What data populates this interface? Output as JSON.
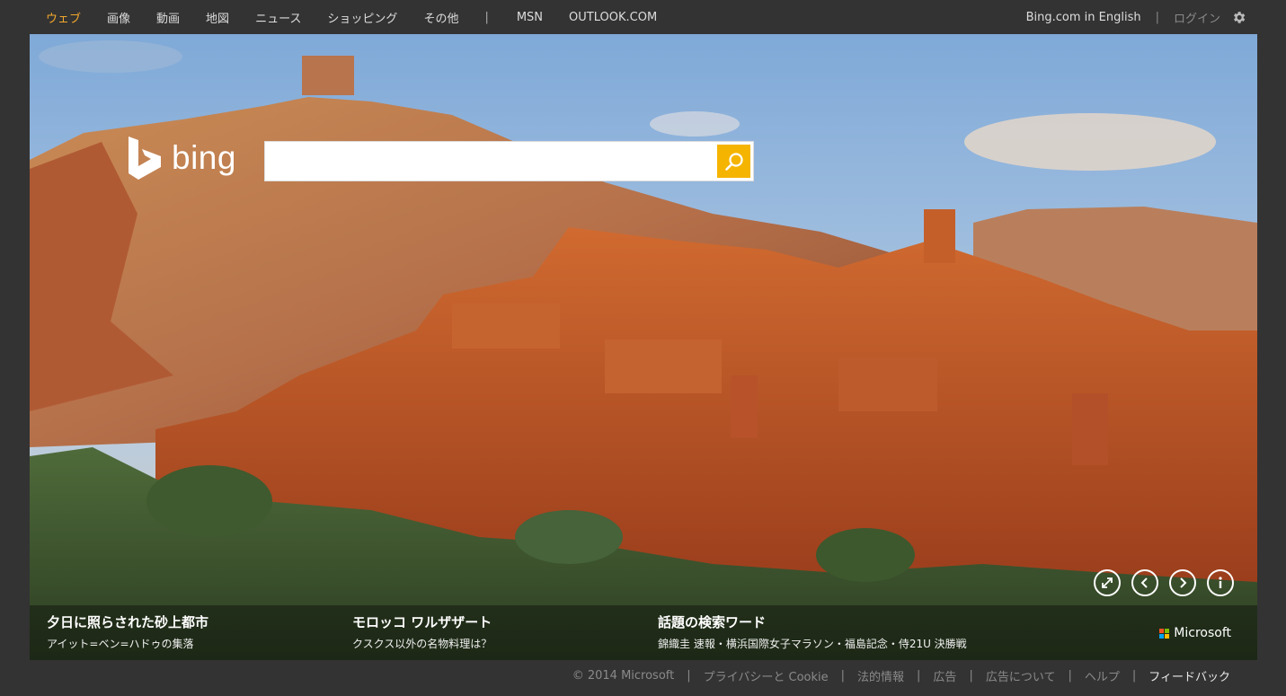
{
  "nav": {
    "left": [
      {
        "label": "ウェブ",
        "active": true
      },
      {
        "label": "画像"
      },
      {
        "label": "動画"
      },
      {
        "label": "地図"
      },
      {
        "label": "ニュース"
      },
      {
        "label": "ショッピング"
      },
      {
        "label": "その他"
      }
    ],
    "separator": "|",
    "right_links": [
      {
        "label": "MSN"
      },
      {
        "label": "OUTLOOK.COM"
      }
    ],
    "english_link": "Bing.com in English",
    "login_link": "ログイン",
    "settings_icon": "gear-icon"
  },
  "logo": {
    "word": "bing"
  },
  "search": {
    "value": "",
    "placeholder": ""
  },
  "controls": [
    "expand-icon",
    "previous-icon",
    "next-icon",
    "info-icon"
  ],
  "stories": [
    {
      "title": "夕日に照らされた砂上都市",
      "subtitle": "アイット=ベン=ハドゥの集落"
    },
    {
      "title": "モロッコ ワルザザート",
      "subtitle": "クスクス以外の名物料理は？"
    },
    {
      "title": "話題の検索ワード",
      "subtitle": "錦織圭 速報・横浜国際女子マラソン・福島記念・侍21U 決勝戦"
    }
  ],
  "brand": {
    "label": "Microsoft"
  },
  "footer": {
    "items": [
      {
        "label": "© 2014 Microsoft"
      },
      {
        "label": "プライバシーと Cookie"
      },
      {
        "label": "法的情報"
      },
      {
        "label": "広告"
      },
      {
        "label": "広告について"
      },
      {
        "label": "ヘルプ"
      },
      {
        "label": "フィードバック"
      }
    ]
  },
  "colors": {
    "accent": "#f3a82d",
    "search_button": "#f5b400",
    "background": "#333333"
  }
}
